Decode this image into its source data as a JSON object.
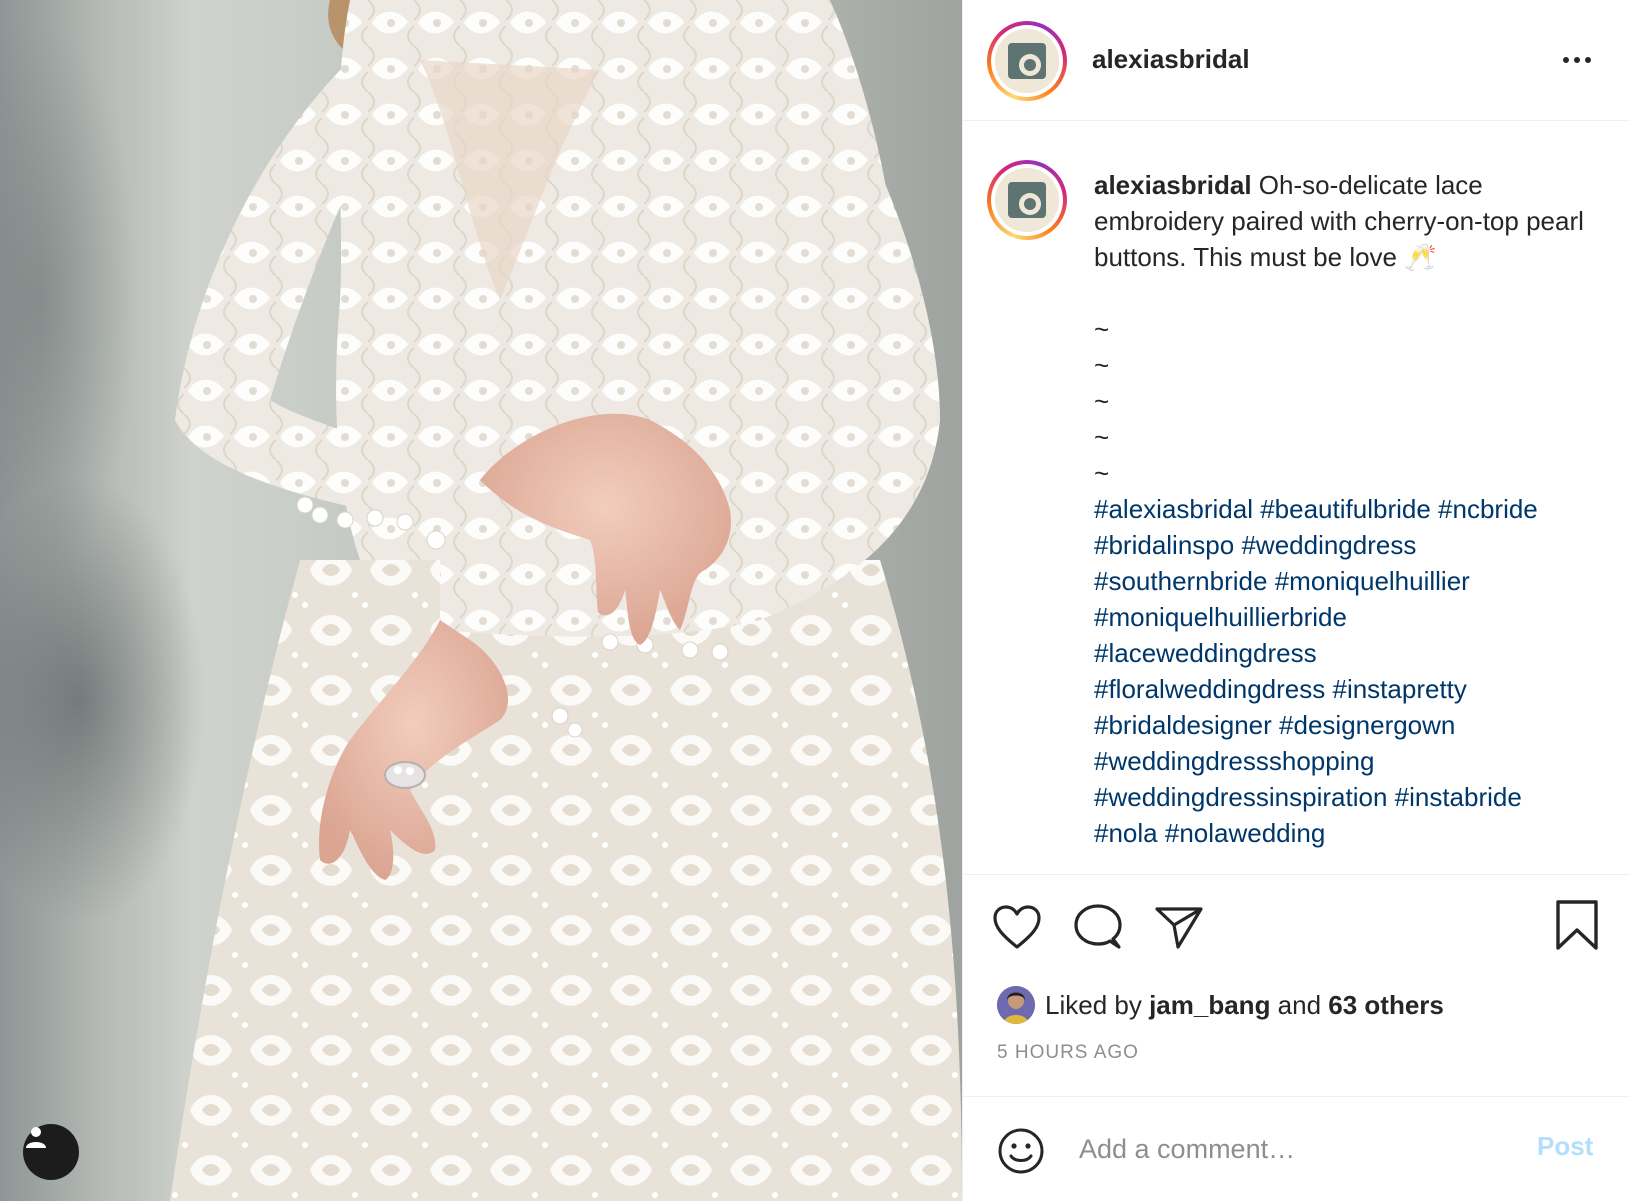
{
  "post": {
    "username": "alexiasbridal",
    "caption_text": " Oh-so-delicate lace embroidery paired with cherry-on-top pearl buttons. This must be love 🥂",
    "tildes": [
      "~",
      "~",
      "~",
      "~",
      "~"
    ],
    "hashtags": [
      "#alexiasbridal",
      "#beautifulbride",
      "#ncbride",
      "#bridalinspo",
      "#weddingdress",
      "#southernbride",
      "#moniquelhuillier",
      "#moniquelhuillierbride",
      "#laceweddingdress",
      "#floralweddingdress",
      "#instapretty",
      "#bridaldesigner",
      "#designergown",
      "#weddingdressshopping",
      "#weddingdressinspiration",
      "#instabride",
      "#nola",
      "#nolawedding"
    ],
    "likes": {
      "prefix": "Liked by ",
      "user": "jam_bang",
      "middle": " and ",
      "others": "63 others"
    },
    "timestamp": "5 HOURS AGO"
  },
  "comment": {
    "placeholder": "Add a comment…",
    "post_label": "Post"
  },
  "icons": {
    "more": "more-options-icon",
    "like": "heart-icon",
    "comment": "comment-bubble-icon",
    "share": "paper-plane-icon",
    "save": "bookmark-icon",
    "emoji": "emoji-icon",
    "user_tag": "user-tag-icon"
  },
  "colors": {
    "hashtag": "#00376b",
    "post_disabled": "#b2dffc",
    "timestamp": "#8e8e8e"
  }
}
